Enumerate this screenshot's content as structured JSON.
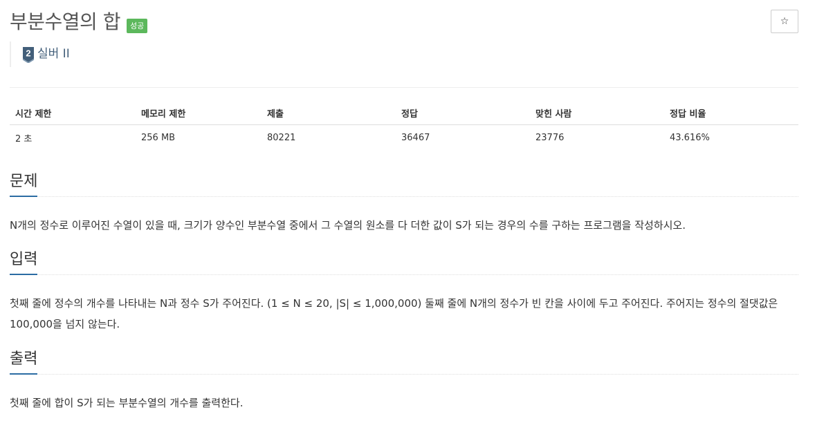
{
  "problem": {
    "title": "부분수열의 합",
    "result_badge": "성공",
    "star_label": "☆",
    "tier_number": "2",
    "tier_label": "실버 II"
  },
  "info_table": {
    "headers": [
      "시간 제한",
      "메모리 제한",
      "제출",
      "정답",
      "맞힌 사람",
      "정답 비율"
    ],
    "values": [
      "2 초",
      "256 MB",
      "80221",
      "36467",
      "23776",
      "43.616%"
    ]
  },
  "sections": {
    "problem": {
      "title": "문제",
      "text": "N개의 정수로 이루어진 수열이 있을 때, 크기가 양수인 부분수열 중에서 그 수열의 원소를 다 더한 값이 S가 되는 경우의 수를 구하는 프로그램을 작성하시오."
    },
    "input": {
      "title": "입력",
      "text": "첫째 줄에 정수의 개수를 나타내는 N과 정수 S가 주어진다. (1 ≤ N ≤ 20, |S| ≤ 1,000,000) 둘째 줄에 N개의 정수가 빈 칸을 사이에 두고 주어진다. 주어지는 정수의 절댓값은 100,000을 넘지 않는다."
    },
    "output": {
      "title": "출력",
      "text": "첫째 줄에 합이 S가 되는 부분수열의 개수를 출력한다."
    }
  },
  "colors": {
    "success_badge": "#5cb85c",
    "tier_silver": "#435f7a",
    "section_underline": "#2b6ca3"
  },
  "icons": {
    "tier": "silver-tier-icon",
    "star": "star-icon"
  }
}
